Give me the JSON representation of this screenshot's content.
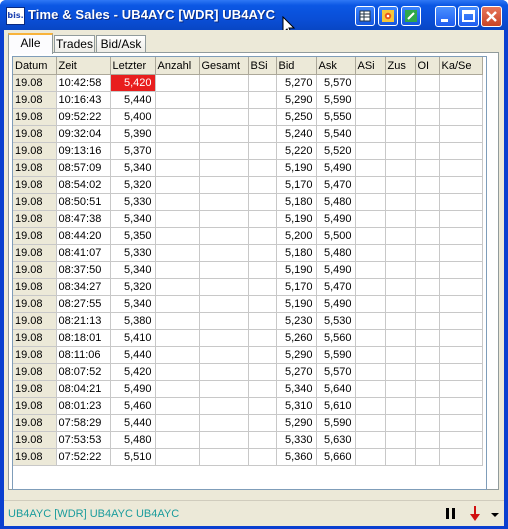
{
  "window": {
    "title": "Time & Sales - UB4AYC [WDR]  UB4AYC",
    "app_icon_text": "bis.",
    "colors": {
      "titlebar": "#0a4fd8",
      "highlight": "#e81e1e",
      "status_text": "#1a9c9c"
    }
  },
  "title_buttons": [
    "grid-view-icon",
    "settings-star-icon",
    "edit-icon"
  ],
  "window_controls": [
    "minimize-icon",
    "maximize-icon",
    "close-icon"
  ],
  "tabs": [
    {
      "label": "Alle"
    },
    {
      "label": "Trades"
    },
    {
      "label": "Bid/Ask"
    }
  ],
  "table": {
    "columns": [
      "Datum",
      "Zeit",
      "Letzter",
      "Anzahl",
      "Gesamt",
      "BSi",
      "Bid",
      "Ask",
      "ASi",
      "Zus",
      "OI",
      "Ka/Se"
    ],
    "rows": [
      [
        "19.08",
        "10:42:58",
        "5,420",
        "",
        "",
        "",
        "5,270",
        "5,570",
        "",
        "",
        "",
        ""
      ],
      [
        "19.08",
        "10:16:43",
        "5,440",
        "",
        "",
        "",
        "5,290",
        "5,590",
        "",
        "",
        "",
        ""
      ],
      [
        "19.08",
        "09:52:22",
        "5,400",
        "",
        "",
        "",
        "5,250",
        "5,550",
        "",
        "",
        "",
        ""
      ],
      [
        "19.08",
        "09:32:04",
        "5,390",
        "",
        "",
        "",
        "5,240",
        "5,540",
        "",
        "",
        "",
        ""
      ],
      [
        "19.08",
        "09:13:16",
        "5,370",
        "",
        "",
        "",
        "5,220",
        "5,520",
        "",
        "",
        "",
        ""
      ],
      [
        "19.08",
        "08:57:09",
        "5,340",
        "",
        "",
        "",
        "5,190",
        "5,490",
        "",
        "",
        "",
        ""
      ],
      [
        "19.08",
        "08:54:02",
        "5,320",
        "",
        "",
        "",
        "5,170",
        "5,470",
        "",
        "",
        "",
        ""
      ],
      [
        "19.08",
        "08:50:51",
        "5,330",
        "",
        "",
        "",
        "5,180",
        "5,480",
        "",
        "",
        "",
        ""
      ],
      [
        "19.08",
        "08:47:38",
        "5,340",
        "",
        "",
        "",
        "5,190",
        "5,490",
        "",
        "",
        "",
        ""
      ],
      [
        "19.08",
        "08:44:20",
        "5,350",
        "",
        "",
        "",
        "5,200",
        "5,500",
        "",
        "",
        "",
        ""
      ],
      [
        "19.08",
        "08:41:07",
        "5,330",
        "",
        "",
        "",
        "5,180",
        "5,480",
        "",
        "",
        "",
        ""
      ],
      [
        "19.08",
        "08:37:50",
        "5,340",
        "",
        "",
        "",
        "5,190",
        "5,490",
        "",
        "",
        "",
        ""
      ],
      [
        "19.08",
        "08:34:27",
        "5,320",
        "",
        "",
        "",
        "5,170",
        "5,470",
        "",
        "",
        "",
        ""
      ],
      [
        "19.08",
        "08:27:55",
        "5,340",
        "",
        "",
        "",
        "5,190",
        "5,490",
        "",
        "",
        "",
        ""
      ],
      [
        "19.08",
        "08:21:13",
        "5,380",
        "",
        "",
        "",
        "5,230",
        "5,530",
        "",
        "",
        "",
        ""
      ],
      [
        "19.08",
        "08:18:01",
        "5,410",
        "",
        "",
        "",
        "5,260",
        "5,560",
        "",
        "",
        "",
        ""
      ],
      [
        "19.08",
        "08:11:06",
        "5,440",
        "",
        "",
        "",
        "5,290",
        "5,590",
        "",
        "",
        "",
        ""
      ],
      [
        "19.08",
        "08:07:52",
        "5,420",
        "",
        "",
        "",
        "5,270",
        "5,570",
        "",
        "",
        "",
        ""
      ],
      [
        "19.08",
        "08:04:21",
        "5,490",
        "",
        "",
        "",
        "5,340",
        "5,640",
        "",
        "",
        "",
        ""
      ],
      [
        "19.08",
        "08:01:23",
        "5,460",
        "",
        "",
        "",
        "5,310",
        "5,610",
        "",
        "",
        "",
        ""
      ],
      [
        "19.08",
        "07:58:29",
        "5,440",
        "",
        "",
        "",
        "5,290",
        "5,590",
        "",
        "",
        "",
        ""
      ],
      [
        "19.08",
        "07:53:53",
        "5,480",
        "",
        "",
        "",
        "5,330",
        "5,630",
        "",
        "",
        "",
        ""
      ],
      [
        "19.08",
        "07:52:22",
        "5,510",
        "",
        "",
        "",
        "5,360",
        "5,660",
        "",
        "",
        "",
        ""
      ]
    ],
    "highlighted_cell": {
      "row": 0,
      "column": "Letzter"
    }
  },
  "status": {
    "text": "UB4AYC [WDR]  UB4AYC   UB4AYC",
    "buttons": [
      "pause-icon",
      "arrow-down-icon",
      "dropdown-icon"
    ]
  }
}
